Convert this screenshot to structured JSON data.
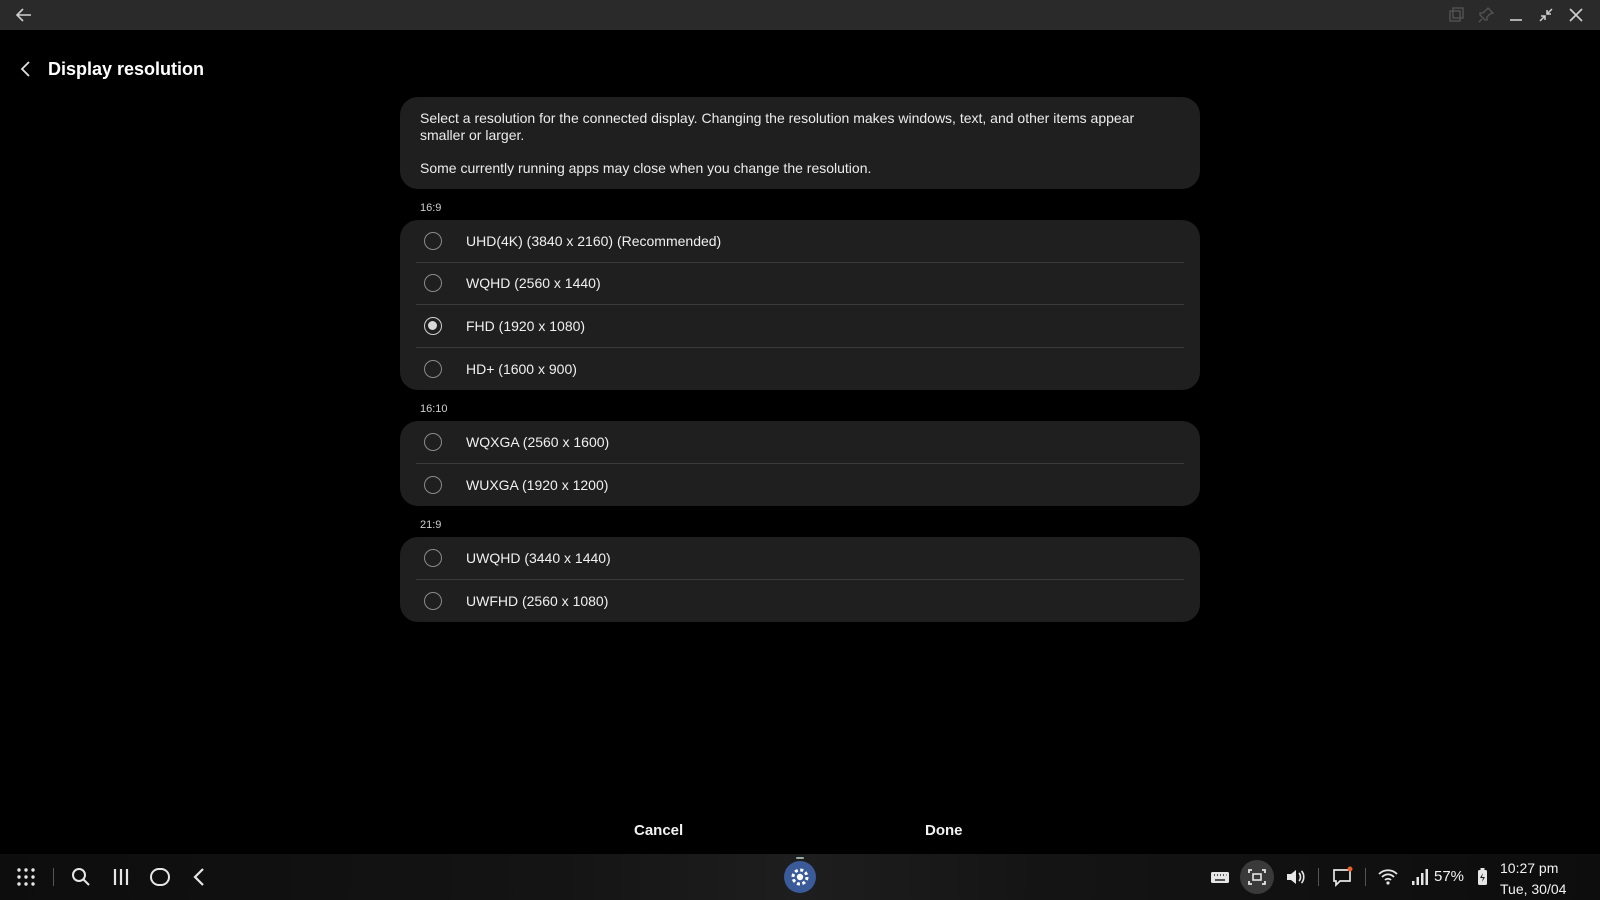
{
  "header": {
    "title": "Display resolution"
  },
  "info": {
    "line1": "Select a resolution for the connected display. Changing the resolution makes windows, text, and other items appear smaller or larger.",
    "line2": "Some currently running apps may close when you change the resolution."
  },
  "groups": [
    {
      "label": "16:9",
      "options": [
        {
          "label": "UHD(4K) (3840 x 2160) (Recommended)",
          "selected": false
        },
        {
          "label": "WQHD (2560 x 1440)",
          "selected": false
        },
        {
          "label": "FHD (1920 x 1080)",
          "selected": true
        },
        {
          "label": "HD+ (1600 x 900)",
          "selected": false
        }
      ]
    },
    {
      "label": "16:10",
      "options": [
        {
          "label": "WQXGA (2560 x 1600)",
          "selected": false
        },
        {
          "label": "WUXGA (1920 x 1200)",
          "selected": false
        }
      ]
    },
    {
      "label": "21:9",
      "options": [
        {
          "label": "UWQHD (3440 x 1440)",
          "selected": false
        },
        {
          "label": "UWFHD (2560 x 1080)",
          "selected": false
        }
      ]
    }
  ],
  "buttons": {
    "cancel": "Cancel",
    "done": "Done"
  },
  "taskbar": {
    "battery": "57%",
    "time": "10:27 pm",
    "date": "Tue, 30/04"
  },
  "colors": {
    "background": "#000000",
    "card": "#1f1f1f",
    "titlebar": "#2a2a2a",
    "settings_app": "#3b5a9a"
  }
}
